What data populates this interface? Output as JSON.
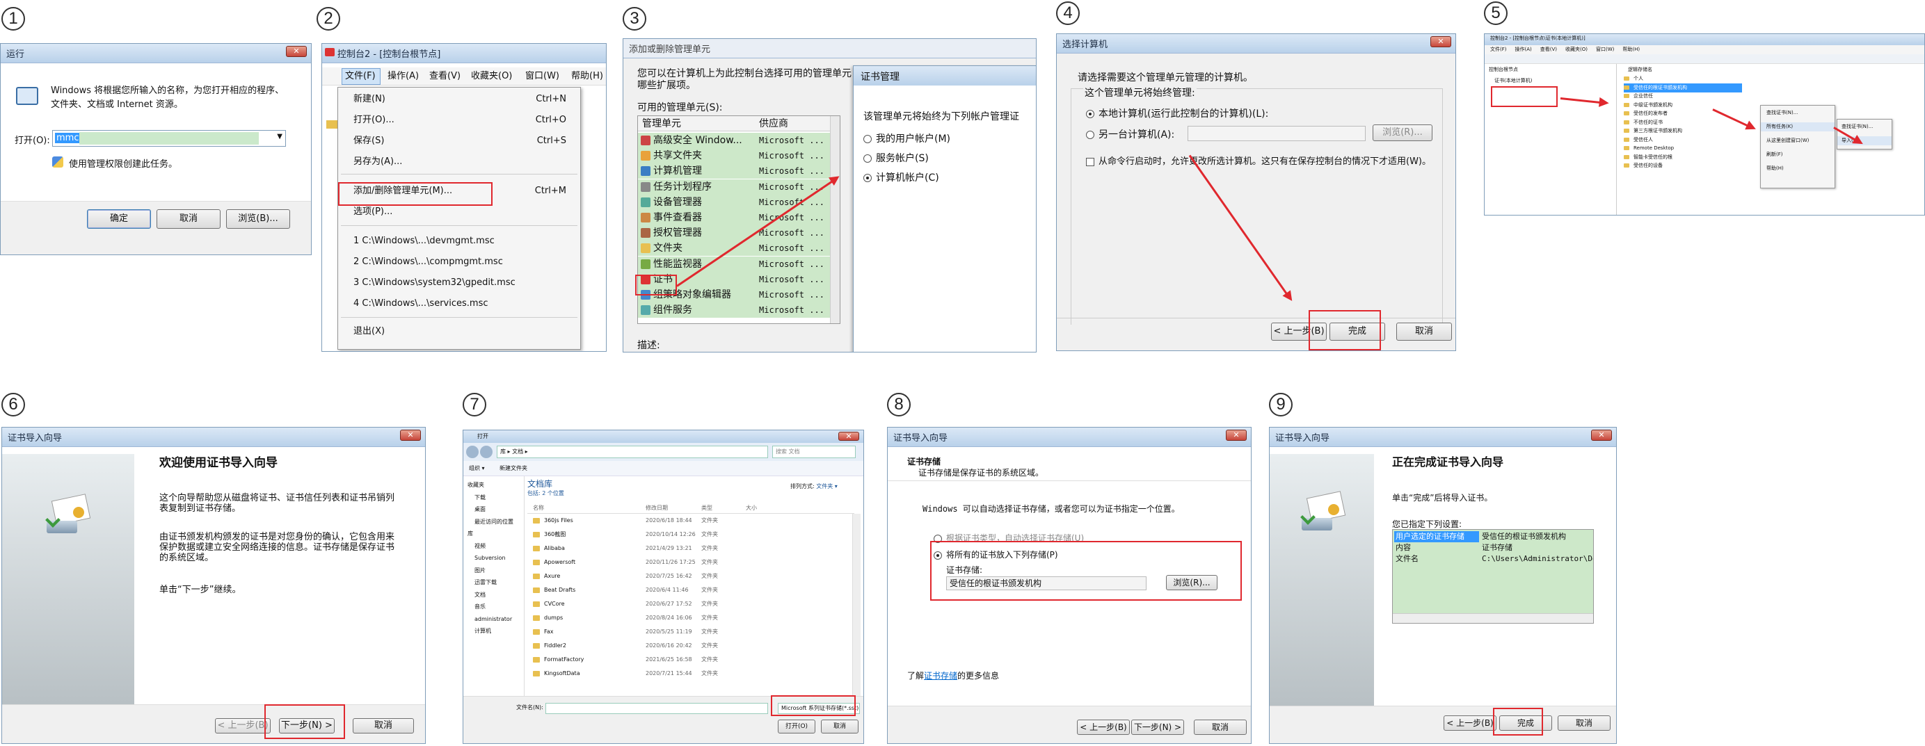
{
  "steps": [
    "1",
    "2",
    "3",
    "4",
    "5",
    "6",
    "7",
    "8",
    "9"
  ],
  "panel1": {
    "title": "运行",
    "desc_line1": "Windows 将根据您所输入的名称，为您打开相应的程序、",
    "desc_line2": "文件夹、文档或 Internet 资源。",
    "open_label": "打开(O):",
    "open_value": "mmc",
    "admin_note": "使用管理权限创建此任务。",
    "ok": "确定",
    "cancel": "取消",
    "browse": "浏览(B)..."
  },
  "panel2": {
    "title": "控制台2 - [控制台根节点]",
    "menubar": [
      "文件(F)",
      "操作(A)",
      "查看(V)",
      "收藏夹(O)",
      "窗口(W)",
      "帮助(H)"
    ],
    "menu": [
      {
        "label": "新建(N)",
        "shortcut": "Ctrl+N"
      },
      {
        "label": "打开(O)...",
        "shortcut": "Ctrl+O"
      },
      {
        "label": "保存(S)",
        "shortcut": "Ctrl+S"
      },
      {
        "label": "另存为(A)...",
        "shortcut": ""
      },
      {
        "label": "添加/删除管理单元(M)...",
        "shortcut": "Ctrl+M"
      },
      {
        "label": "选项(P)...",
        "shortcut": ""
      },
      {
        "label": "1 C:\\Windows\\...\\devmgmt.msc",
        "shortcut": ""
      },
      {
        "label": "2 C:\\Windows\\...\\compmgmt.msc",
        "shortcut": ""
      },
      {
        "label": "3 C:\\Windows\\system32\\gpedit.msc",
        "shortcut": ""
      },
      {
        "label": "4 C:\\Windows\\...\\services.msc",
        "shortcut": ""
      },
      {
        "label": "退出(X)",
        "shortcut": ""
      }
    ]
  },
  "panel3": {
    "title": "添加或删除管理单元",
    "intro": "您可以在计算机上为此控制台选择可用的管理单元",
    "intro2": "哪些扩展项。",
    "avail_label": "可用的管理单元(S):",
    "col_snapin": "管理单元",
    "col_vendor": "供应商",
    "items": [
      {
        "name": "高级安全 Window...",
        "vendor": "Microsoft ..."
      },
      {
        "name": "共享文件夹",
        "vendor": "Microsoft ..."
      },
      {
        "name": "计算机管理",
        "vendor": "Microsoft ..."
      },
      {
        "name": "任务计划程序",
        "vendor": "Microsoft ..."
      },
      {
        "name": "设备管理器",
        "vendor": "Microsoft ..."
      },
      {
        "name": "事件查看器",
        "vendor": "Microsoft ..."
      },
      {
        "name": "授权管理器",
        "vendor": "Microsoft ..."
      },
      {
        "name": "文件夹",
        "vendor": "Microsoft ..."
      },
      {
        "name": "性能监视器",
        "vendor": "Microsoft ..."
      },
      {
        "name": "证书",
        "vendor": "Microsoft ..."
      },
      {
        "name": "组策略对象编辑器",
        "vendor": "Microsoft ..."
      },
      {
        "name": "组件服务",
        "vendor": "Microsoft ..."
      }
    ],
    "desc_label": "描述:",
    "sub_title": "证书管理",
    "sub_text": "该管理单元将始终为下列帐户管理证",
    "options": [
      "我的用户帐户(M)",
      "服务帐户(S)",
      "计算机帐户(C)"
    ]
  },
  "panel4": {
    "title": "选择计算机",
    "line1": "请选择需要这个管理单元管理的计算机。",
    "line2": "这个管理单元将始终管理:",
    "opt_local": "本地计算机(运行此控制台的计算机)(L):",
    "opt_other": "另一台计算机(A):",
    "browse": "浏览(R)...",
    "checkbox": "从命令行启动时，允许更改所选计算机。这只有在保存控制台的情况下才适用(W)。",
    "back": "< 上一步(B)",
    "finish": "完成",
    "cancel": "取消"
  },
  "panel5": {
    "title": "控制台2 - [控制台根节点\\证书(本地计算机)]",
    "menubar": [
      "文件(F)",
      "操作(A)",
      "查看(V)",
      "收藏夹(O)",
      "窗口(W)",
      "帮助(H)"
    ],
    "tree_root": "控制台根节点",
    "tree_cert": "证书(本地计算机)",
    "col": "逻辑存储名",
    "stores": [
      "个人",
      "受信任的根证书颁发机构",
      "企业信任",
      "中级证书颁发机构",
      "受信任的发布者",
      "不信任的证书",
      "第三方根证书颁发机构",
      "受信任人",
      "Remote Desktop",
      "智能卡受信任的根",
      "受信任的设备"
    ],
    "ctx1": [
      "查找证书(N)...",
      "所有任务(K)",
      "从这里创建窗口(W)",
      "刷新(F)",
      "帮助(H)"
    ],
    "ctx2": [
      "查找证书(N)...",
      "导入(I)..."
    ]
  },
  "panel6": {
    "title": "证书导入向导",
    "heading": "欢迎使用证书导入向导",
    "p1": "这个向导帮助您从磁盘将证书、证书信任列表和证书吊销列表复制到证书存储。",
    "p2": "由证书颁发机构颁发的证书是对您身份的确认，它包含用来保护数据或建立安全网络连接的信息。证书存储是保存证书的系统区域。",
    "p3": "单击“下一步”继续。",
    "back": "< 上一步(B)",
    "next": "下一步(N) >",
    "cancel": "取消"
  },
  "panel7": {
    "title": "打开",
    "path": "库 ▸ 文档 ▸",
    "search": "搜索 文档",
    "organize": "组织 ▾",
    "newfolder": "新建文件夹",
    "lib_title": "文档库",
    "lib_sub": "包括: 2 个位置",
    "arrange": "排列方式:",
    "arrange_val": "文件夹 ▾",
    "cols": [
      "名称",
      "修改日期",
      "类型",
      "大小"
    ],
    "files": [
      {
        "name": "360js Files",
        "date": "2020/6/18 18:44",
        "type": "文件夹"
      },
      {
        "name": "360截图",
        "date": "2020/10/14 12:26",
        "type": "文件夹"
      },
      {
        "name": "Alibaba",
        "date": "2021/4/29 13:21",
        "type": "文件夹"
      },
      {
        "name": "Apowersoft",
        "date": "2020/11/26 17:25",
        "type": "文件夹"
      },
      {
        "name": "Axure",
        "date": "2020/7/25 16:42",
        "type": "文件夹"
      },
      {
        "name": "Beat Drafts",
        "date": "2020/6/4 11:46",
        "type": "文件夹"
      },
      {
        "name": "CVCore",
        "date": "2020/6/27 17:52",
        "type": "文件夹"
      },
      {
        "name": "dumps",
        "date": "2020/8/24 16:06",
        "type": "文件夹"
      },
      {
        "name": "Fax",
        "date": "2020/5/25 11:19",
        "type": "文件夹"
      },
      {
        "name": "Fiddler2",
        "date": "2020/6/16 20:42",
        "type": "文件夹"
      },
      {
        "name": "FormatFactory",
        "date": "2021/6/25 16:58",
        "type": "文件夹"
      },
      {
        "name": "KingsoftData",
        "date": "2020/7/21 15:44",
        "type": "文件夹"
      }
    ],
    "nav": [
      "收藏夹",
      "下载",
      "桌面",
      "最近访问的位置",
      "库",
      "视频",
      "Subversion",
      "图片",
      "迅雷下载",
      "文档",
      "音乐",
      "administrator",
      "计算机"
    ],
    "filename_label": "文件名(N):",
    "filetype": "Microsoft 系列证书存储(*.sst)",
    "open": "打开(O)",
    "cancel": "取消"
  },
  "panel8": {
    "title": "证书导入向导",
    "section": "证书存储",
    "section_sub": "证书存储是保存证书的系统区域。",
    "body": "Windows 可以自动选择证书存储，或者您可以为证书指定一个位置。",
    "opt_auto": "根据证书类型，自动选择证书存储(U)",
    "opt_manual": "将所有的证书放入下列存储(P)",
    "store_label": "证书存储:",
    "store_value": "受信任的根证书颁发机构",
    "browse": "浏览(R)...",
    "learn_pre": "了解",
    "learn_link": "证书存储",
    "learn_post": "的更多信息",
    "back": "< 上一步(B)",
    "next": "下一步(N) >",
    "cancel": "取消"
  },
  "panel9": {
    "title": "证书导入向导",
    "heading": "正在完成证书导入向导",
    "p1": "单击“完成”后将导入证书。",
    "p2": "您已指定下列设置:",
    "rows": [
      {
        "k": "用户选定的证书存储",
        "v": "受信任的根证书颁发机构"
      },
      {
        "k": "内容",
        "v": "证书存储"
      },
      {
        "k": "文件名",
        "v": "C:\\Users\\Administrator\\Docu"
      }
    ],
    "back": "< 上一步(B)",
    "finish": "完成",
    "cancel": "取消"
  }
}
